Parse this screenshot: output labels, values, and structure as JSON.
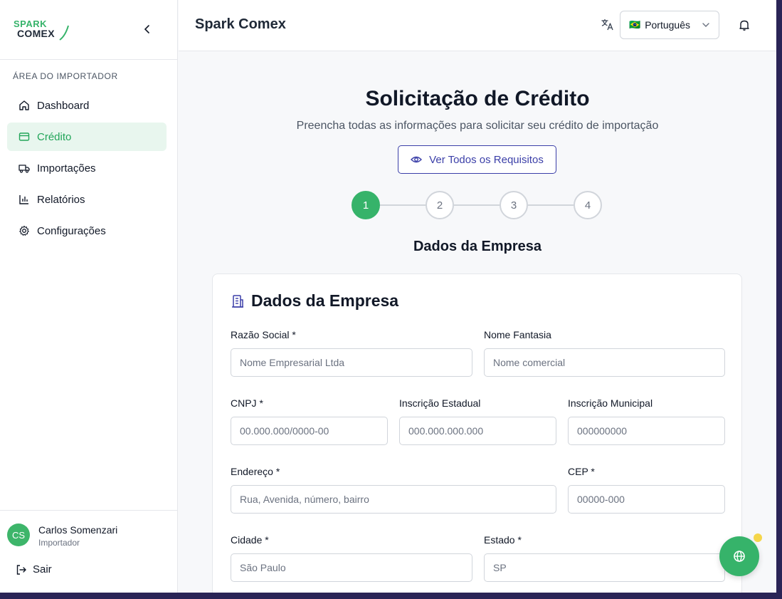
{
  "app": {
    "logo_top": "SPARK",
    "logo_bottom": "COMEX",
    "header_title": "Spark Comex"
  },
  "colors": {
    "brand_green": "#36b36a",
    "accent_indigo": "#3b3fa8"
  },
  "sidebar": {
    "section_label": "ÁREA DO IMPORTADOR",
    "items": [
      {
        "label": "Dashboard",
        "icon": "home-icon",
        "active": false
      },
      {
        "label": "Crédito",
        "icon": "credit-card-icon",
        "active": true
      },
      {
        "label": "Importações",
        "icon": "truck-icon",
        "active": false
      },
      {
        "label": "Relatórios",
        "icon": "bar-chart-icon",
        "active": false
      },
      {
        "label": "Configurações",
        "icon": "gear-icon",
        "active": false
      }
    ],
    "user": {
      "initials": "CS",
      "name": "Carlos Somenzari",
      "role": "Importador"
    },
    "logout_label": "Sair"
  },
  "header": {
    "language": {
      "flag": "🇧🇷",
      "selected": "Português"
    }
  },
  "page": {
    "title": "Solicitação de Crédito",
    "subtitle": "Preencha todas as informações para solicitar seu crédito de importação",
    "requirements_button": "Ver Todos os Requisitos",
    "steps": [
      "1",
      "2",
      "3",
      "4"
    ],
    "current_step": 1,
    "step_title": "Dados da Empresa"
  },
  "form": {
    "card_title": "Dados da Empresa",
    "fields": {
      "razao_social": {
        "label": "Razão Social *",
        "placeholder": "Nome Empresarial Ltda"
      },
      "nome_fantasia": {
        "label": "Nome Fantasia",
        "placeholder": "Nome comercial"
      },
      "cnpj": {
        "label": "CNPJ *",
        "placeholder": "00.000.000/0000-00"
      },
      "inscricao_estadual": {
        "label": "Inscrição Estadual",
        "placeholder": "000.000.000.000"
      },
      "inscricao_municipal": {
        "label": "Inscrição Municipal",
        "placeholder": "000000000"
      },
      "endereco": {
        "label": "Endereço *",
        "placeholder": "Rua, Avenida, número, bairro"
      },
      "cep": {
        "label": "CEP *",
        "placeholder": "00000-000"
      },
      "cidade": {
        "label": "Cidade *",
        "placeholder": "São Paulo"
      },
      "estado": {
        "label": "Estado *",
        "placeholder": "SP"
      }
    }
  }
}
